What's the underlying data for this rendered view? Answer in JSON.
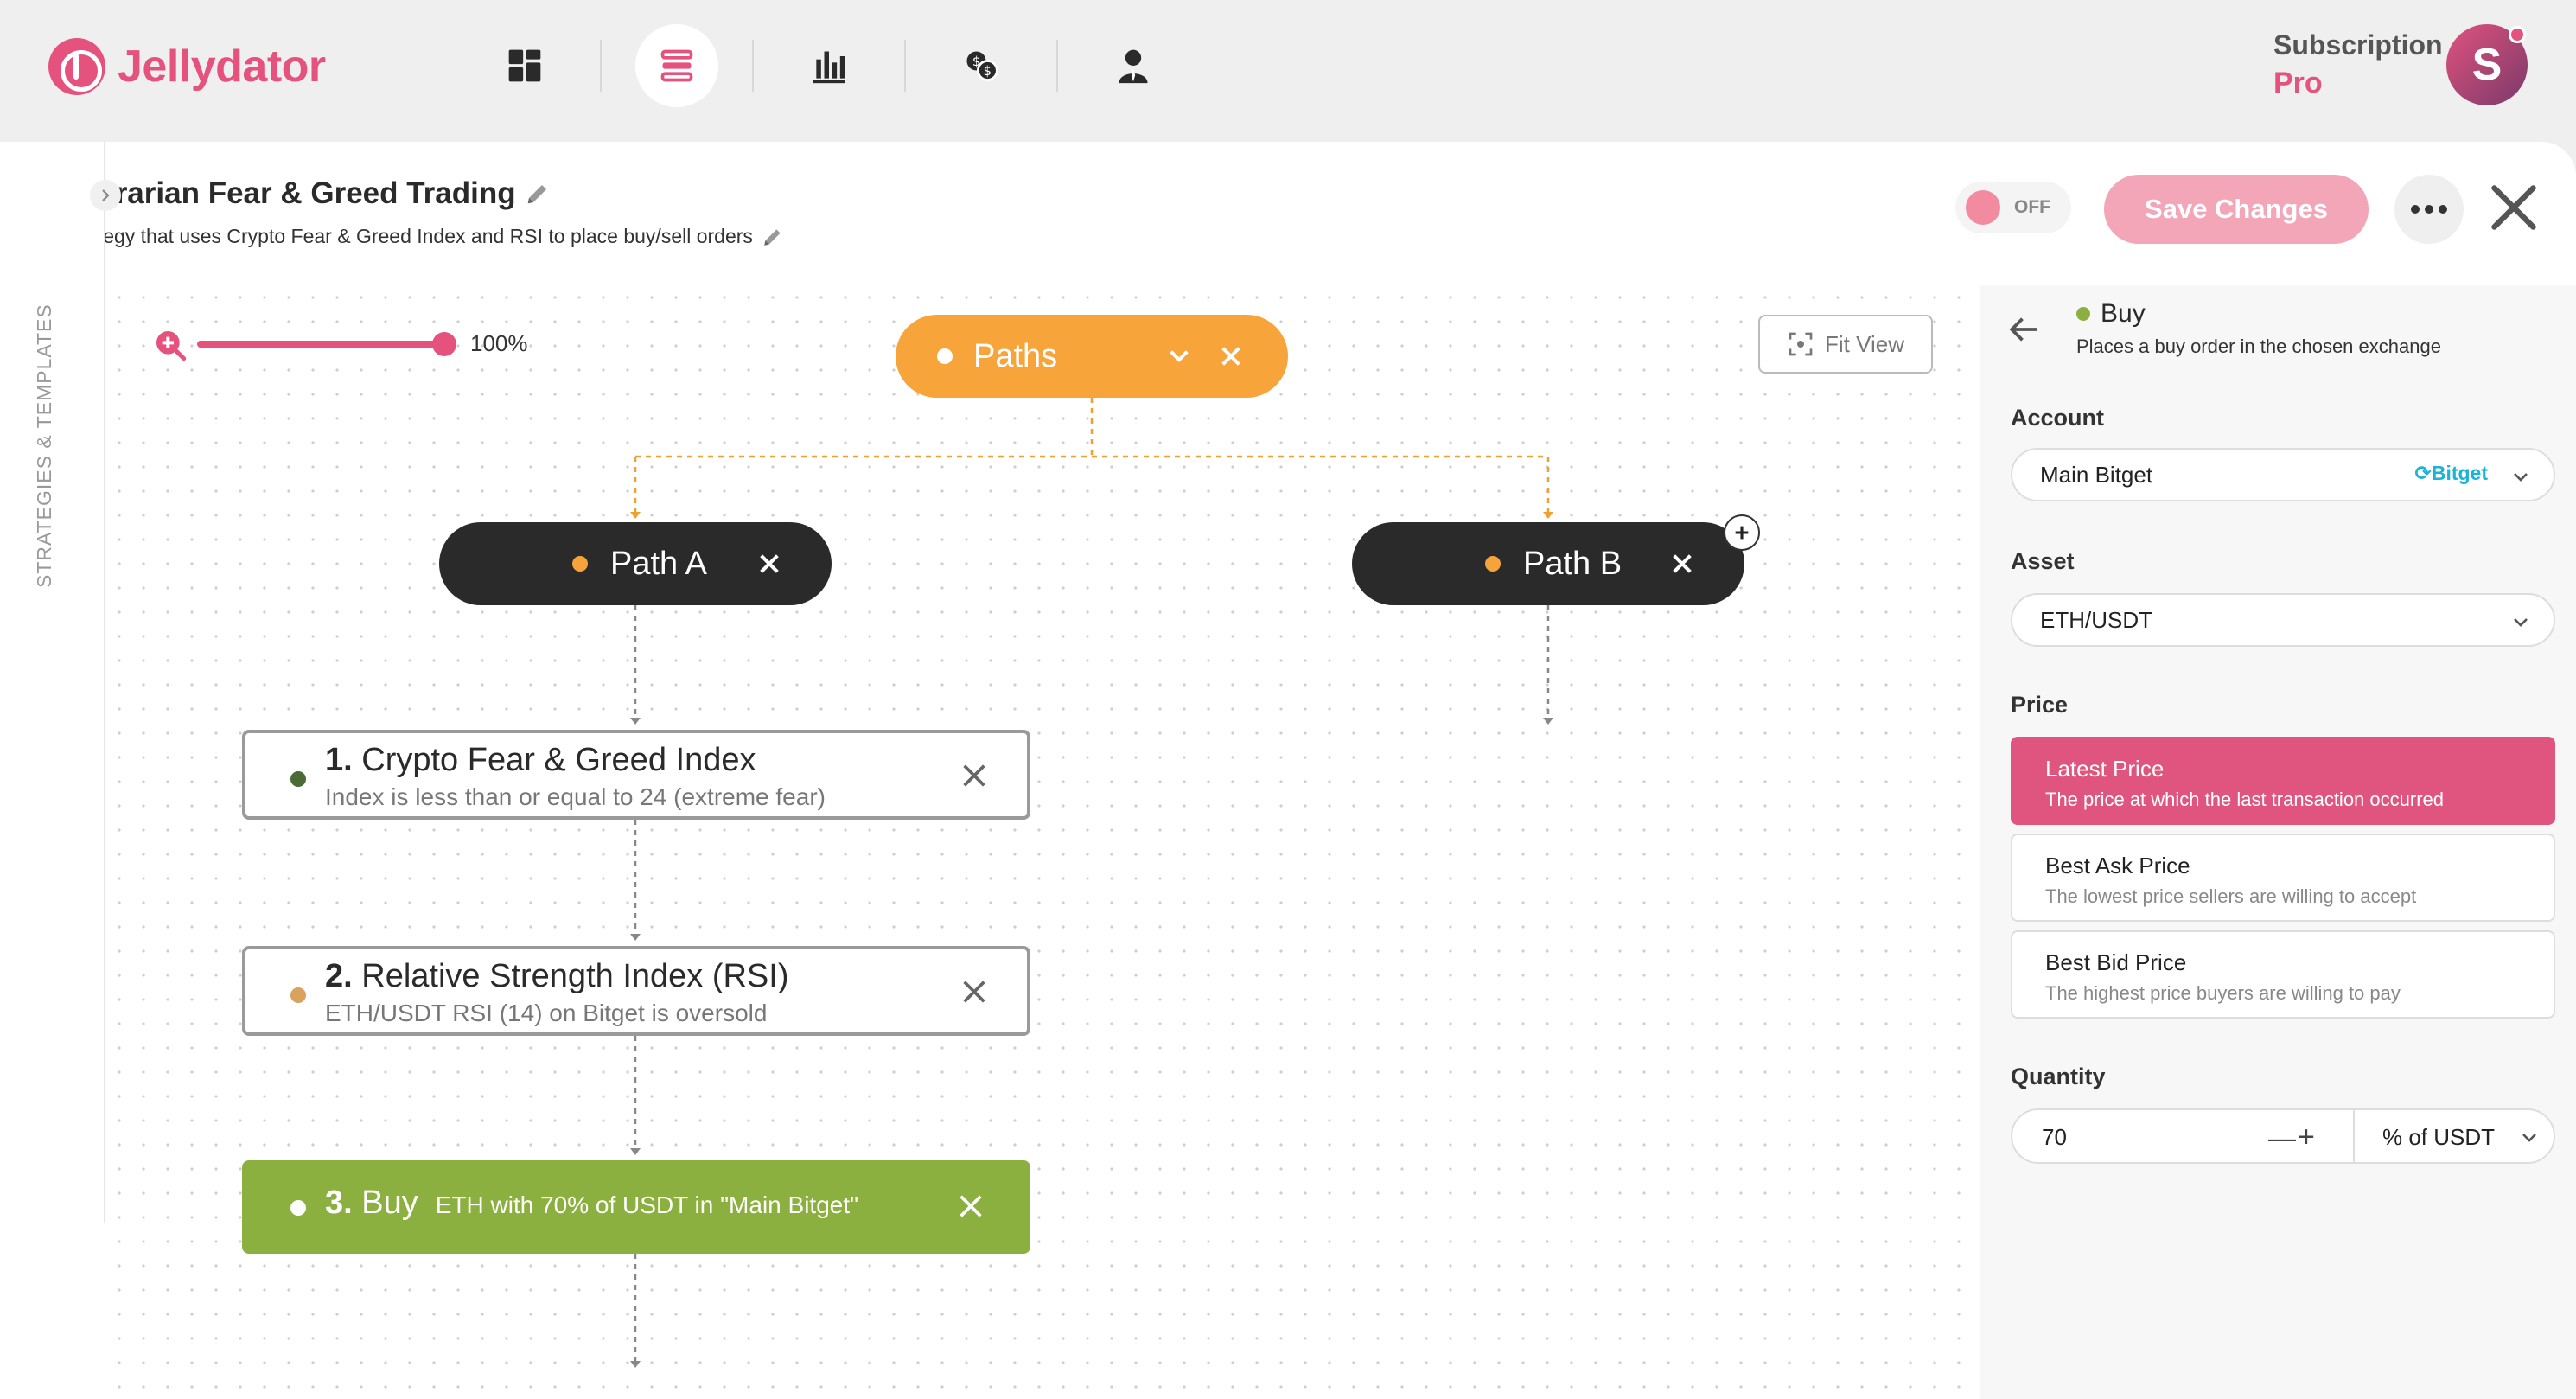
{
  "brand": {
    "name": "Jellydator"
  },
  "nav": {
    "items": [
      {
        "icon": "dashboard-icon"
      },
      {
        "icon": "strategies-icon",
        "active": true
      },
      {
        "icon": "bar-chart-icon"
      },
      {
        "icon": "exchange-icon"
      },
      {
        "icon": "user-icon"
      }
    ]
  },
  "subscription": {
    "label": "Subscription",
    "tier": "Pro"
  },
  "user": {
    "initial": "S"
  },
  "strategy": {
    "title": "Contrarian Fear & Greed Trading",
    "description": "A strategy that uses Crypto Fear & Greed Index and RSI to place buy/sell orders"
  },
  "toolbar": {
    "toggle_label": "OFF",
    "save_label": "Save Changes"
  },
  "sidebar": {
    "label": "STRATEGIES & TEMPLATES"
  },
  "canvas": {
    "zoom": "100%",
    "fit_view_label": "Fit View",
    "paths_label": "Paths",
    "path_a": "Path A",
    "path_b": "Path B",
    "nodes": [
      {
        "number": "1.",
        "title": "Crypto Fear & Greed Index",
        "desc": "Index is less than or equal to 24 (extreme fear)",
        "dot_color": "#4a6b35"
      },
      {
        "number": "2.",
        "title": "Relative Strength Index (RSI)",
        "desc": "ETH/USDT RSI (14) on Bitget is oversold",
        "dot_color": "#d9a35f"
      },
      {
        "number": "3.",
        "title": "Buy",
        "desc": "ETH with 70% of USDT in \"Main Bitget\""
      }
    ]
  },
  "panel": {
    "title": "Buy",
    "desc": "Places a buy order in the chosen exchange",
    "account_label": "Account",
    "account_value": "Main Bitget",
    "account_exchange": "Bitget",
    "asset_label": "Asset",
    "asset_value": "ETH/USDT",
    "price_label": "Price",
    "price_options": [
      {
        "title": "Latest Price",
        "desc": "The price at which the last transaction occurred",
        "selected": true
      },
      {
        "title": "Best Ask Price",
        "desc": "The lowest price sellers are willing to accept"
      },
      {
        "title": "Best Bid Price",
        "desc": "The highest price buyers are willing to pay"
      }
    ],
    "quantity_label": "Quantity",
    "quantity_value": "70",
    "quantity_unit": "% of USDT"
  },
  "colors": {
    "accent": "#e4527d",
    "paths": "#f7a53b",
    "buy": "#8cb040",
    "dark_pill": "#2a2a2a"
  }
}
